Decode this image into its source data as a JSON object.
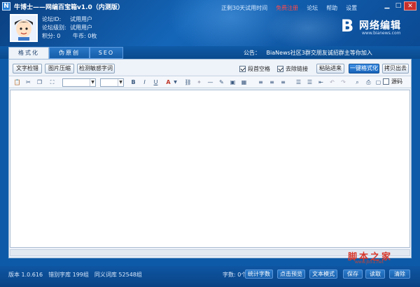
{
  "window": {
    "title": "牛博士——网编百宝箱v1.0（内测版）",
    "links": [
      "正剩30天试用时间",
      "免费注册",
      "论坛",
      "帮助",
      "设置"
    ]
  },
  "user": {
    "rows": [
      {
        "k": "论坛ID:",
        "v": "试用用户"
      },
      {
        "k": "论坛级别:",
        "v": "试用用户"
      }
    ],
    "points_label": "积分: 0",
    "coins_label": "牛币: 0枚"
  },
  "logo": {
    "glyph": "B",
    "text": "网络编辑",
    "url": "www.bianews.com"
  },
  "tabs": [
    "格式化",
    "伪原创",
    "SEO"
  ],
  "notice": {
    "label": "公告：",
    "text": "BiaNews社区3群交朋友诚招群主等你加入"
  },
  "row1": {
    "buttons": [
      "文字检错",
      "图片压缩",
      "检测敏感字词"
    ],
    "checkboxes": [
      "段首空格",
      "去除链接"
    ],
    "right_buttons": [
      "粘贴进来",
      "一键格式化",
      "拷贝出去"
    ]
  },
  "toolbar": {
    "code_label": "源码",
    "icons": [
      "B",
      "I",
      "U",
      "A"
    ]
  },
  "status": {
    "items": [
      "版本 1.0.616",
      "错别字库 199组",
      "同义词库 52548组"
    ],
    "count_text": "字数: 0个",
    "buttons": [
      "统计字数",
      "点击预览",
      "文本模式",
      "保存",
      "读取",
      "清除"
    ]
  },
  "watermark": {
    "text": "脚本之家",
    "url": "www.jb51.net"
  },
  "colors": {
    "accent": "#0d5ba8",
    "close": "#c9302c",
    "primary": "#1763b8",
    "hot": "#ff4a4a"
  }
}
